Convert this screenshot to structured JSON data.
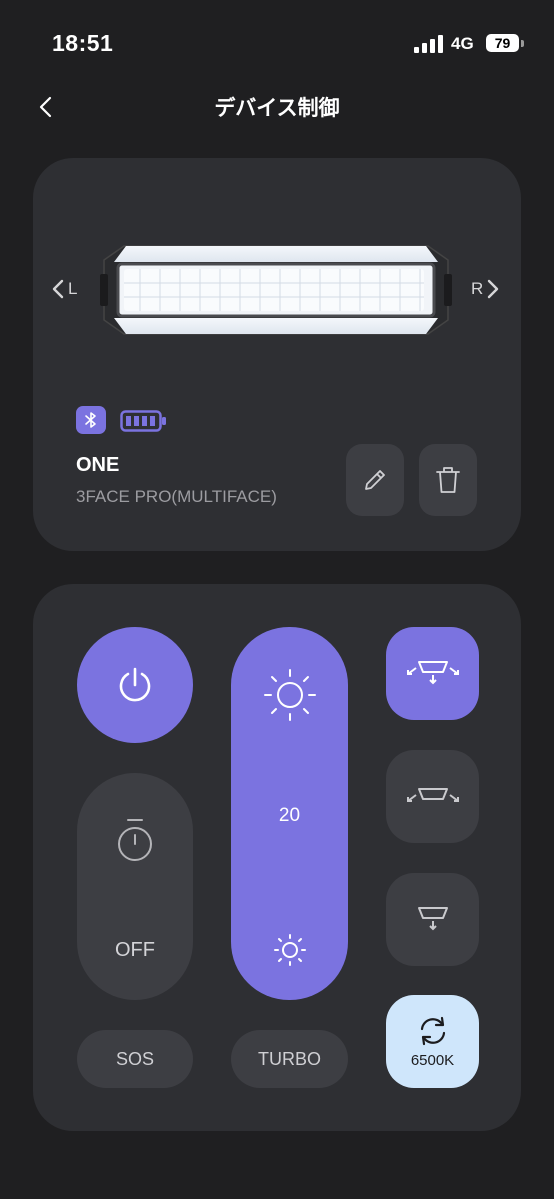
{
  "status_bar": {
    "time": "18:51",
    "network": "4G",
    "battery": "79"
  },
  "header": {
    "title": "デバイス制御"
  },
  "device": {
    "nav_left": "L",
    "nav_right": "R",
    "name": "ONE",
    "model": "3FACE PRO(MULTIFACE)",
    "battery_level": 1.0
  },
  "controls": {
    "timer_label": "OFF",
    "brightness_value": "20",
    "sos_label": "SOS",
    "turbo_label": "TURBO",
    "color_temp_label": "6500K",
    "accent_color": "#7b73e0",
    "color_temp_bg": "#cfe6fb"
  },
  "icons": [
    "back-icon",
    "bluetooth-icon",
    "battery-icon",
    "pencil-icon",
    "trash-icon",
    "power-icon",
    "stopwatch-icon",
    "sun-large-icon",
    "sun-small-icon",
    "mode-wide-icon",
    "mode-sides-icon",
    "mode-down-icon",
    "refresh-icon"
  ]
}
